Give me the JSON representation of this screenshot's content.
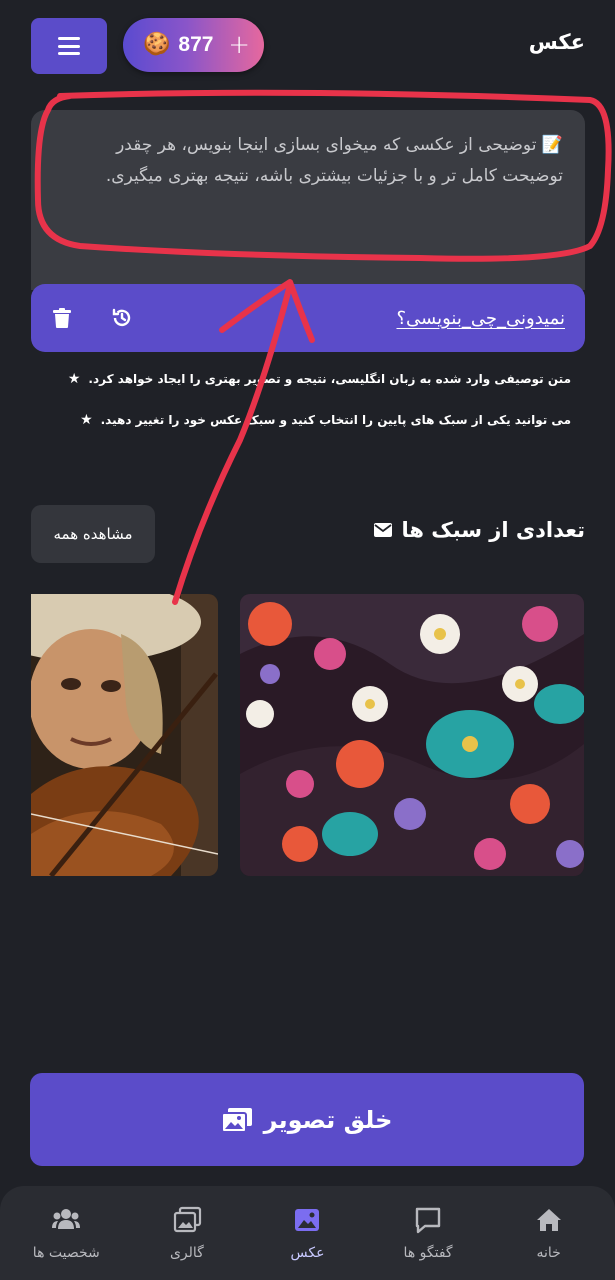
{
  "header": {
    "title": "عکس",
    "coins": "877",
    "add_symbol": "+",
    "cookie_icon": "🍪"
  },
  "prompt": {
    "placeholder": "📝 توضیحی از عکسی که میخوای بسازی اینجا بنویس، هر چقدر توضیحت کامل تر و با جزئیات بیشتری باشه، نتیجه بهتری میگیری.",
    "help_link": "نمیدونی_چی_بنویسی؟"
  },
  "notes": [
    "متن توصیفی وارد شده به زبان انگلیسی، نتیجه و تصویر بهتری را ایجاد خواهد کرد.",
    "می توانید یکی از سبک های پایین را انتخاب کنید و سبک عکس خود را تغییر دهید."
  ],
  "styles_section": {
    "title": "تعدادی از سبک ها",
    "see_all": "مشاهده همه"
  },
  "create_button": {
    "label": "خلق تصویر"
  },
  "nav": {
    "home": "خانه",
    "chat": "گفتگو ها",
    "photo": "عکس",
    "gallery": "گالری",
    "characters": "شخصیت ها"
  },
  "colors": {
    "accent": "#5b4cc9",
    "background": "#1f2127",
    "annotation": "#e8334a"
  }
}
